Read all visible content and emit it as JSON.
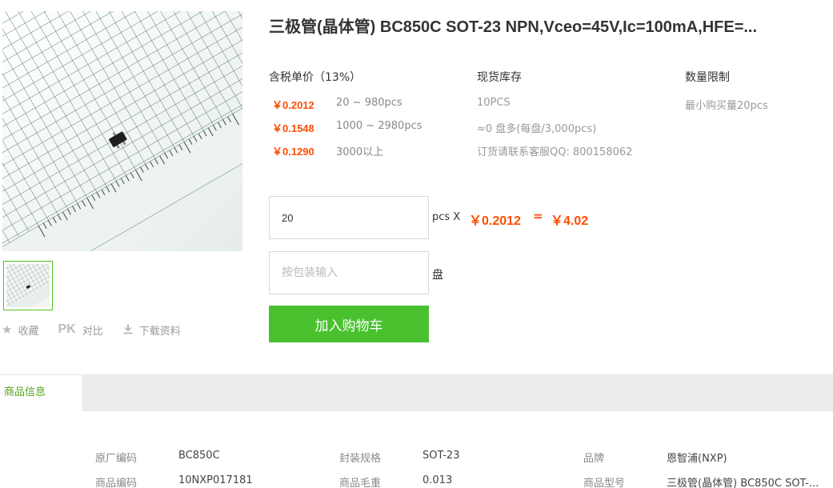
{
  "product": {
    "title": "三极管(晶体管) BC850C SOT-23 NPN,Vceo=45V,Ic=100mA,HFE=..."
  },
  "pricing": {
    "header": "含税单价（13%）",
    "tiers": [
      {
        "price": "￥0.2012",
        "range": "20 ~ 980pcs"
      },
      {
        "price": "￥0.1548",
        "range": "1000 ~ 2980pcs"
      },
      {
        "price": "￥0.1290",
        "range": "3000以上"
      }
    ]
  },
  "stock": {
    "header": "现货库存",
    "lines": [
      "10PCS",
      "≈0 盘多(每盘/3,000pcs)",
      "订货请联系客服QQ: 800158062"
    ]
  },
  "limit": {
    "header": "数量限制",
    "text": "最小购买量20pcs"
  },
  "order": {
    "quantity_value": "20",
    "quantity_unit": "pcs X",
    "unit_price": "￥0.2012",
    "equals": "=",
    "total": "￥4.02",
    "package_placeholder": "按包装输入",
    "package_unit": "盘",
    "add_to_cart_label": "加入购物车"
  },
  "actions": {
    "favorite_label": "收藏",
    "compare_prefix": "PK",
    "compare_label": "对比",
    "download_label": "下载资料",
    "icons": [
      "star-icon",
      "pk-icon",
      "download-icon"
    ]
  },
  "tabs": {
    "active_label": "商品信息"
  },
  "specs": [
    {
      "label": "原厂编码",
      "value": "BC850C"
    },
    {
      "label": "封装规格",
      "value": "SOT-23"
    },
    {
      "label": "品牌",
      "value": "恩智浦(NXP)"
    },
    {
      "label": "商品编码",
      "value": "10NXP017181"
    },
    {
      "label": "商品毛重",
      "value": "0.013"
    },
    {
      "label": "商品型号",
      "value": "三极管(晶体管) BC850C SOT-..."
    }
  ],
  "colors": {
    "accent_green": "#49c12f",
    "price_orange": "#ff4d00",
    "tab_green": "#52a21e"
  }
}
